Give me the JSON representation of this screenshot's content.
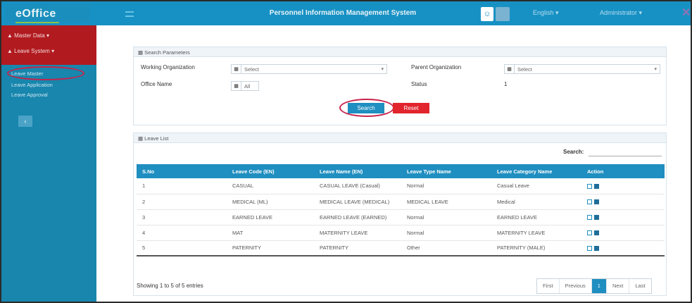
{
  "header": {
    "logo": "eOffice",
    "title": "Personnel Information Management System",
    "language_menu": "English",
    "profile_menu": "Administrator"
  },
  "sidebar": {
    "groups": [
      {
        "label": "Master Data"
      },
      {
        "label": "Leave System"
      }
    ],
    "items": [
      {
        "label": "Leave Master"
      },
      {
        "label": "Leave Application"
      },
      {
        "label": "Leave Approval"
      }
    ],
    "collapse_label": "‹"
  },
  "filter_panel": {
    "title": "Search Parameters",
    "fields": [
      {
        "label": "Working Organization",
        "value": "Select",
        "type": "select"
      },
      {
        "label": "Parent Organization",
        "value": "Select",
        "type": "select"
      },
      {
        "label": "Office Name",
        "value": "All",
        "type": "select"
      },
      {
        "label": "Status",
        "value": "",
        "type": "text"
      }
    ],
    "status_value": "1",
    "search_button": "Search",
    "reset_button": "Reset"
  },
  "results_panel": {
    "title": "Leave List",
    "search_label": "Search:",
    "columns": [
      "S.No",
      "Leave Code (EN)",
      "Leave Name (EN)",
      "Leave Type Name",
      "Leave Category Name",
      "Action"
    ],
    "rows": [
      [
        "1",
        "CASUAL",
        "CASUAL LEAVE (Casual)",
        "Normal",
        "Casual Leave",
        ""
      ],
      [
        "2",
        "MEDICAL (ML)",
        "MEDICAL LEAVE (MEDICAL)",
        "MEDICAL LEAVE",
        "Medical",
        ""
      ],
      [
        "3",
        "EARNED LEAVE",
        "EARNED LEAVE (EARNED)",
        "Normal",
        "EARNED LEAVE",
        ""
      ],
      [
        "4",
        "MAT",
        "MATERNITY LEAVE",
        "Normal",
        "MATERNITY LEAVE",
        ""
      ],
      [
        "5",
        "PATERNITY",
        "PATERNITY",
        "Other",
        "PATERNITY (MALE)",
        ""
      ]
    ],
    "footer_info": "Showing 1 to 5 of 5 entries",
    "pager": [
      "First",
      "Previous",
      "1",
      "Next",
      "Last"
    ]
  },
  "colors": {
    "header_blue": "#1791c4",
    "sidebar_blue": "#1886ad",
    "sidebar_red": "#b11a1f",
    "accent_red": "#e2242c",
    "annotation_circle": "#c8234b"
  }
}
